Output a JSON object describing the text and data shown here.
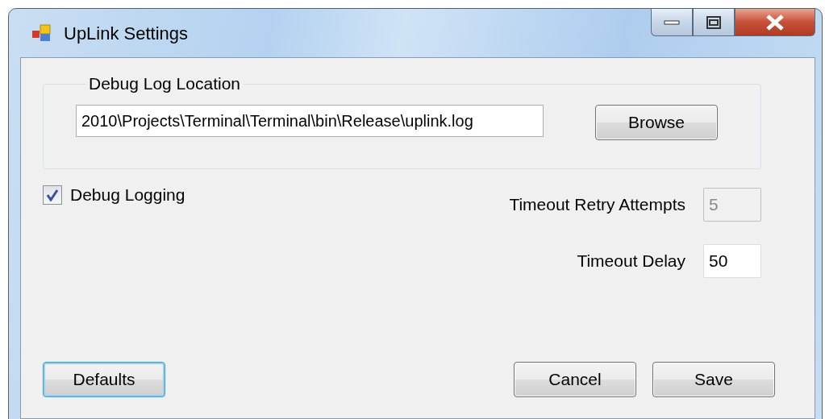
{
  "window": {
    "title": "UpLink Settings"
  },
  "log_group": {
    "title": "Debug Log Location",
    "path": {
      "value": "2010\\Projects\\Terminal\\Terminal\\bin\\Release\\uplink.log"
    },
    "browse_button": "Browse"
  },
  "debug_logging": {
    "label": "Debug Logging",
    "checked": true
  },
  "fields": [
    {
      "label": "Timeout Retry Attempts",
      "value": "5",
      "disabled": true
    },
    {
      "label": "Timeout Delay",
      "value": "50",
      "disabled": false
    }
  ],
  "buttons": [
    {
      "label": "Defaults",
      "focused": true
    },
    {
      "label": "Cancel",
      "focused": false
    },
    {
      "label": "Save",
      "focused": false
    }
  ]
}
